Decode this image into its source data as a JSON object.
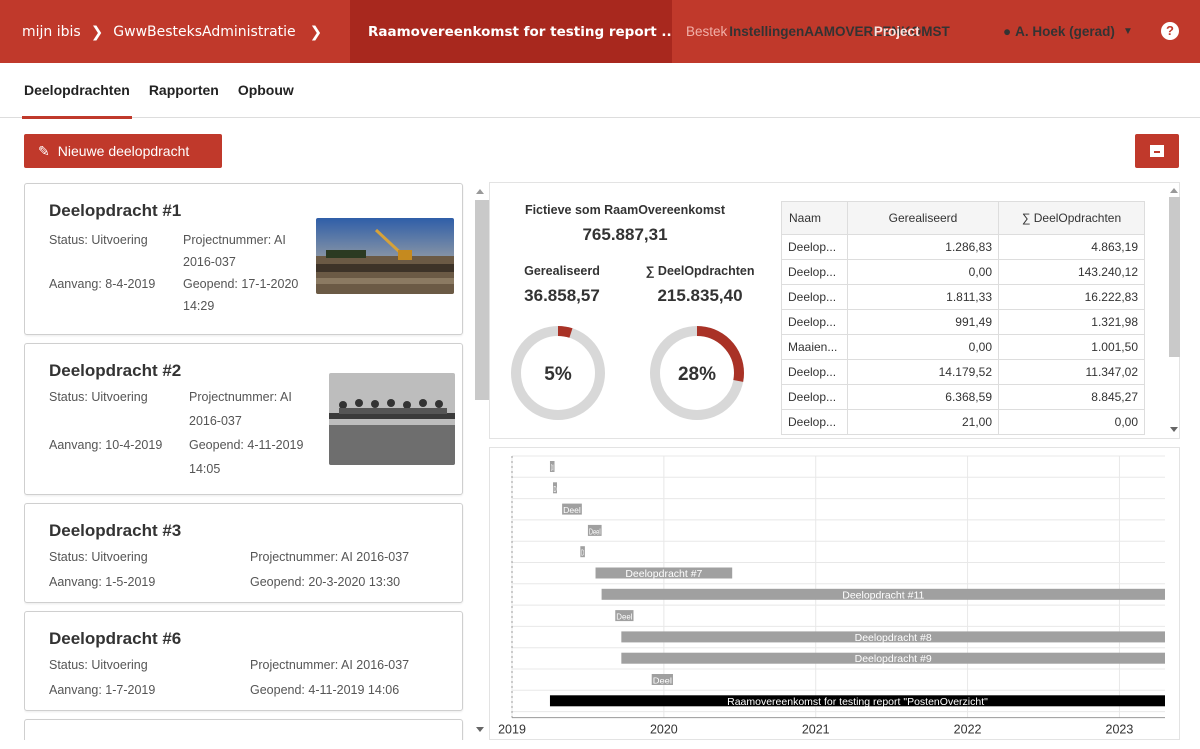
{
  "topbar": {
    "breadcrumb_home": "mijn ibis",
    "breadcrumb_admin": "GwwBesteksAdministratie",
    "breadcrumb_current": "Raamovereenkomst for testing report ...",
    "nav_overlap_faded": "Bestek",
    "nav_overlap_main": "InstellingenAAMOVEREENKOMST",
    "nav_overlap_project": "Project",
    "user_label": "A. Hoek (gerad)",
    "help": "?"
  },
  "tabs": [
    "Deelopdrachten",
    "Rapporten",
    "Opbouw"
  ],
  "new_button": "Nieuwe deelopdracht",
  "cards": [
    {
      "title": "Deelopdracht #1",
      "status": "Status: Uitvoering",
      "project_a": "Projectnummer: AI",
      "project_b": "2016-037",
      "start": "Aanvang: 8-4-2019",
      "opened_a": "Geopend: 17-1-2020",
      "opened_b": "14:29"
    },
    {
      "title": "Deelopdracht #2",
      "status": "Status: Uitvoering",
      "project_a": "Projectnummer: AI",
      "project_b": "2016-037",
      "start": "Aanvang: 10-4-2019",
      "opened_a": "Geopend: 4-11-2019",
      "opened_b": "14:05"
    },
    {
      "title": "Deelopdracht #3",
      "status": "Status: Uitvoering",
      "project": "Projectnummer: AI 2016-037",
      "start": "Aanvang: 1-5-2019",
      "opened": "Geopend: 20-3-2020 13:30"
    },
    {
      "title": "Deelopdracht #6",
      "status": "Status: Uitvoering",
      "project": "Projectnummer: AI 2016-037",
      "start": "Aanvang: 1-7-2019",
      "opened": "Geopend: 4-11-2019 14:06"
    }
  ],
  "summary": {
    "fictive_label": "Fictieve som RaamOvereenkomst",
    "fictive_value": "765.887,31",
    "realized_label": "Gerealiseerd",
    "realized_value": "36.858,57",
    "sum_label": "∑ DeelOpdrachten",
    "sum_value": "215.835,40",
    "realized_pct": 5,
    "realized_pct_label": "5%",
    "sum_pct": 28,
    "sum_pct_label": "28%",
    "accent": "#a93226"
  },
  "table": {
    "headers": [
      "Naam",
      "Gerealiseerd",
      "∑ DeelOpdrachten"
    ],
    "rows": [
      [
        "Deelop...",
        "1.286,83",
        "4.863,19"
      ],
      [
        "Deelop...",
        "0,00",
        "143.240,12"
      ],
      [
        "Deelop...",
        "1.811,33",
        "16.222,83"
      ],
      [
        "Deelop...",
        "991,49",
        "1.321,98"
      ],
      [
        "Maaien...",
        "0,00",
        "1.001,50"
      ],
      [
        "Deelop...",
        "14.179,52",
        "11.347,02"
      ],
      [
        "Deelop...",
        "6.368,59",
        "8.845,27"
      ],
      [
        "Deelop...",
        "21,00",
        "0,00"
      ]
    ]
  },
  "chart_data": {
    "type": "gantt",
    "x_ticks": [
      "2019",
      "2020",
      "2021",
      "2022",
      "2023"
    ],
    "xlim": [
      2019.0,
      2023.3
    ],
    "bars": [
      {
        "label": "Dl",
        "start": 2019.25,
        "end": 2019.28,
        "color": "#a0a0a0"
      },
      {
        "label": "D",
        "start": 2019.27,
        "end": 2019.29,
        "color": "#a0a0a0"
      },
      {
        "label": "Deel",
        "start": 2019.33,
        "end": 2019.46,
        "color": "#a0a0a0"
      },
      {
        "label": "Deel",
        "start": 2019.5,
        "end": 2019.59,
        "color": "#a0a0a0"
      },
      {
        "label": "D",
        "start": 2019.45,
        "end": 2019.48,
        "color": "#a0a0a0"
      },
      {
        "label": "Deelopdracht #7",
        "start": 2019.55,
        "end": 2020.45,
        "color": "#a0a0a0"
      },
      {
        "label": "Deelopdracht #11",
        "start": 2019.59,
        "end": 2023.3,
        "color": "#a0a0a0"
      },
      {
        "label": "Deel",
        "start": 2019.68,
        "end": 2019.8,
        "color": "#a0a0a0"
      },
      {
        "label": "Deelopdracht #8",
        "start": 2019.72,
        "end": 2023.3,
        "color": "#a0a0a0"
      },
      {
        "label": "Deelopdracht #9",
        "start": 2019.72,
        "end": 2023.3,
        "color": "#a0a0a0"
      },
      {
        "label": "Deel",
        "start": 2019.92,
        "end": 2020.06,
        "color": "#a0a0a0"
      },
      {
        "label": "Raamovereenkomst for testing report \"PostenOverzicht\"",
        "start": 2019.25,
        "end": 2023.3,
        "color": "#000000"
      }
    ]
  }
}
